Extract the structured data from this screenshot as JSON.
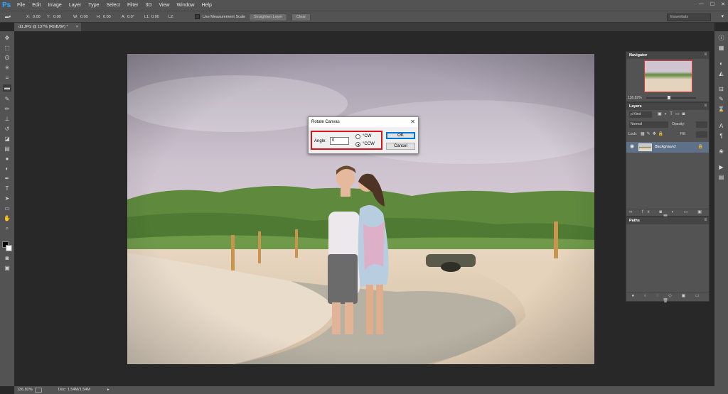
{
  "app": {
    "logo": "Ps"
  },
  "menu": [
    "File",
    "Edit",
    "Image",
    "Layer",
    "Type",
    "Select",
    "Filter",
    "3D",
    "View",
    "Window",
    "Help"
  ],
  "window_controls": {
    "minimize": "—",
    "maximize": "☐",
    "close": "✕"
  },
  "options_bar": {
    "x_label": "X:",
    "x": "0.00",
    "y_label": "Y:",
    "y": "0.00",
    "w_label": "W:",
    "w": "0.00",
    "h_label": "H:",
    "h": "0.00",
    "a_label": "A:",
    "a": "0.0°",
    "l1_label": "L1:",
    "l1": "0.00",
    "l2_label": "L2:",
    "use_measurement": "Use Measurement Scale",
    "straighten": "Straighten Layer",
    "clear": "Clear",
    "workspace": "Essentials"
  },
  "document": {
    "tab": "dd.JPG @ 137% (RGB/8#) *",
    "tab_close": "×"
  },
  "status": {
    "zoom": "136.82%",
    "doc": "Doc: 1.54M/1.54M"
  },
  "dialog": {
    "title": "Rotate Canvas",
    "close": "✕",
    "angle_label": "Angle:",
    "angle_value": "0",
    "cw_label": "°CW",
    "ccw_label": "°CCW",
    "selected": "ccw",
    "ok": "OK",
    "cancel": "Cancel"
  },
  "navigator": {
    "title": "Navigator",
    "zoom": "136.82%"
  },
  "layers": {
    "title": "Layers",
    "kind": "ρ Kind",
    "blend": "Normal",
    "opacity_label": "Opacity:",
    "lock_label": "Lock:",
    "fill_label": "Fill:",
    "layer_name": "Background"
  },
  "paths": {
    "title": "Paths"
  },
  "colors": {
    "ui_panel": "#535353",
    "highlight_red": "#d6141d",
    "ps_blue": "#31a8ff",
    "selected_layer": "#5e7189"
  }
}
